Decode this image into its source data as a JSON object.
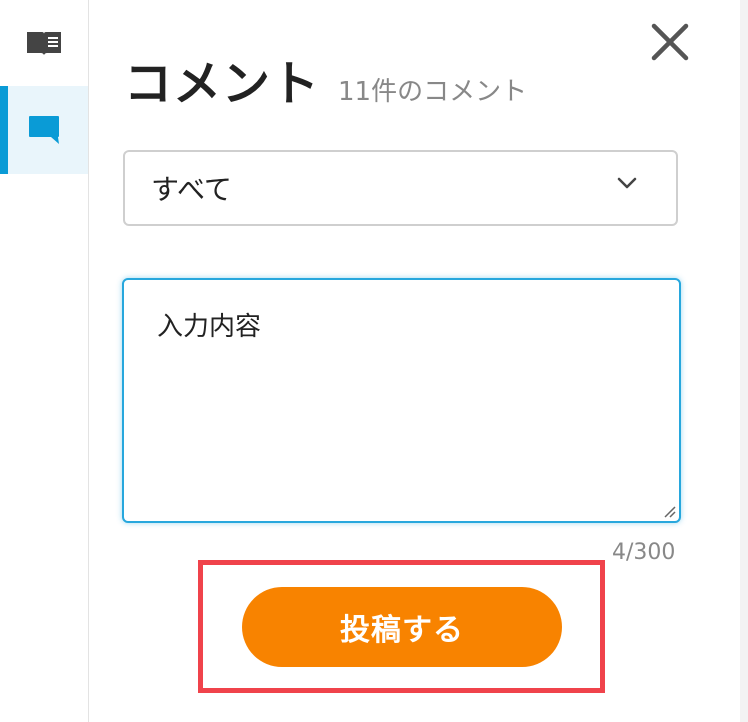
{
  "sidebar": {
    "items": [
      {
        "icon": "book-icon",
        "active": false
      },
      {
        "icon": "comment-icon",
        "active": true
      }
    ],
    "accent_color": "#0a9bd6"
  },
  "header": {
    "title": "コメント",
    "count_text": "11件のコメント"
  },
  "filter": {
    "selected": "すべて"
  },
  "comment_input": {
    "value": "入力内容",
    "char_count": "4/300"
  },
  "submit": {
    "label": "投稿する",
    "color": "#f88300"
  },
  "highlight_color": "#f0434b"
}
